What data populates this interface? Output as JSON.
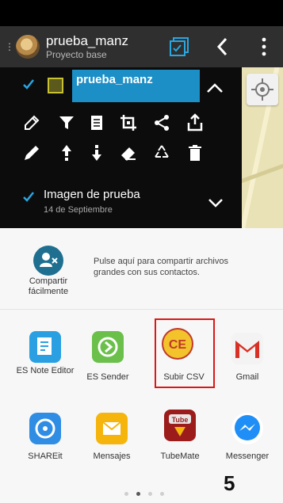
{
  "appbar": {
    "title": "prueba_manz",
    "subtitle": "Proyecto base"
  },
  "layer": {
    "name": "prueba_manz",
    "checked": true
  },
  "image_layer": {
    "title": "Imagen de prueba",
    "date": "14 de Septiembre",
    "checked": true
  },
  "tools_row1": [
    "edit-style-icon",
    "filter-icon",
    "attribute-table-icon",
    "crop-icon",
    "share-icon",
    "export-icon"
  ],
  "tools_row2": [
    "pencil-icon",
    "move-up-icon",
    "move-down-icon",
    "eraser-icon",
    "recycle-icon",
    "trash-icon"
  ],
  "share": {
    "quick_label": "Compartir fácilmente",
    "quick_desc": "Pulse aquí para compartir archivos grandes con sus contactos."
  },
  "apps": [
    {
      "label": "ES Note Editor",
      "icon": "es-note-editor-icon",
      "color": "#2aa0e3"
    },
    {
      "label": "ES Sender",
      "icon": "es-sender-icon",
      "color": "#6ac04a"
    },
    {
      "label": "Subir CSV",
      "icon": "subir-csv-icon",
      "color": "#c0392b"
    },
    {
      "label": "Gmail",
      "icon": "gmail-icon",
      "color": "#d93025"
    },
    {
      "label": "SHAREit",
      "icon": "shareit-icon",
      "color": "#2f8de4"
    },
    {
      "label": "Mensajes",
      "icon": "messages-icon",
      "color": "#f5b50d"
    },
    {
      "label": "TubeMate",
      "icon": "tubemate-icon",
      "color": "#9c1b1b"
    },
    {
      "label": "Messenger",
      "icon": "messenger-icon",
      "color": "#1f8ef7"
    }
  ],
  "pager": {
    "pages": 4,
    "current": 2
  },
  "step": "5"
}
